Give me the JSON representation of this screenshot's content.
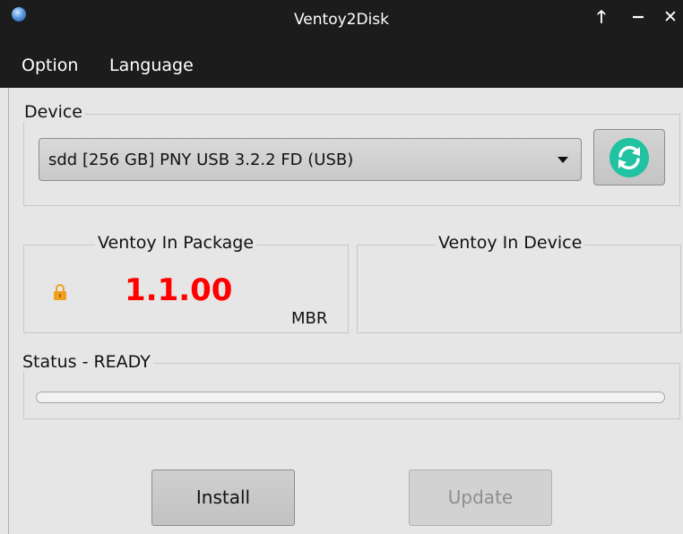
{
  "window": {
    "title": "Ventoy2Disk",
    "maximize_glyph": "🡑",
    "minimize_glyph": "−",
    "close_glyph": "✕"
  },
  "menu": {
    "items": [
      {
        "label": "Option"
      },
      {
        "label": "Language"
      }
    ]
  },
  "device": {
    "legend": "Device",
    "selected": "sdd  [256 GB]  PNY USB 3.2.2 FD (USB)",
    "refresh_icon": "refresh-icon"
  },
  "package": {
    "legend": "Ventoy In Package",
    "version": "1.1.00",
    "partition_style": "MBR",
    "lock_icon": "lock-icon"
  },
  "device_ventoy": {
    "legend": "Ventoy In Device"
  },
  "status": {
    "legend": "Status - READY",
    "progress": 0
  },
  "buttons": {
    "install_label": "Install",
    "update_label": "Update"
  },
  "colors": {
    "version_red": "#ff0000",
    "refresh_teal": "#21c2a1",
    "lock_orange": "#f0a020"
  }
}
